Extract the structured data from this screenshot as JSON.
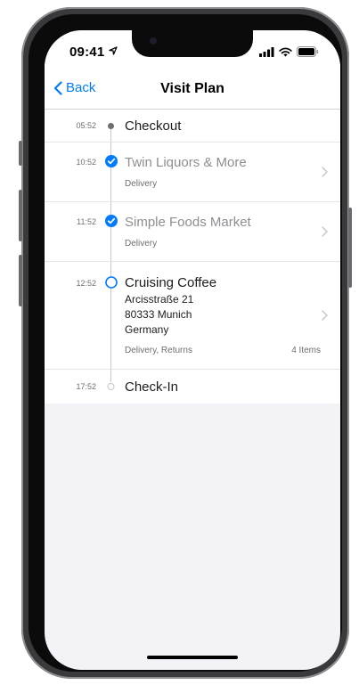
{
  "status_bar": {
    "time": "09:41"
  },
  "nav": {
    "back_label": "Back",
    "title": "Visit Plan"
  },
  "timeline": [
    {
      "time": "05:52",
      "name": "Checkout",
      "state": "done-small"
    },
    {
      "time": "10:52",
      "name": "Twin Liquors & More",
      "subtitle": "Delivery",
      "state": "checked"
    },
    {
      "time": "11:52",
      "name": "Simple Foods Market",
      "subtitle": "Delivery",
      "state": "checked"
    },
    {
      "time": "12:52",
      "name": "Cruising Coffee",
      "address_line1": "Arcisstraße 21",
      "address_line2": "80333 Munich",
      "address_line3": "Germany",
      "subtitle": "Delivery, Returns",
      "items": "4 Items",
      "state": "current"
    },
    {
      "time": "17:52",
      "name": "Check-In",
      "state": "upcoming"
    }
  ],
  "colors": {
    "accent": "#007aff",
    "background": "#f2f2f7"
  }
}
